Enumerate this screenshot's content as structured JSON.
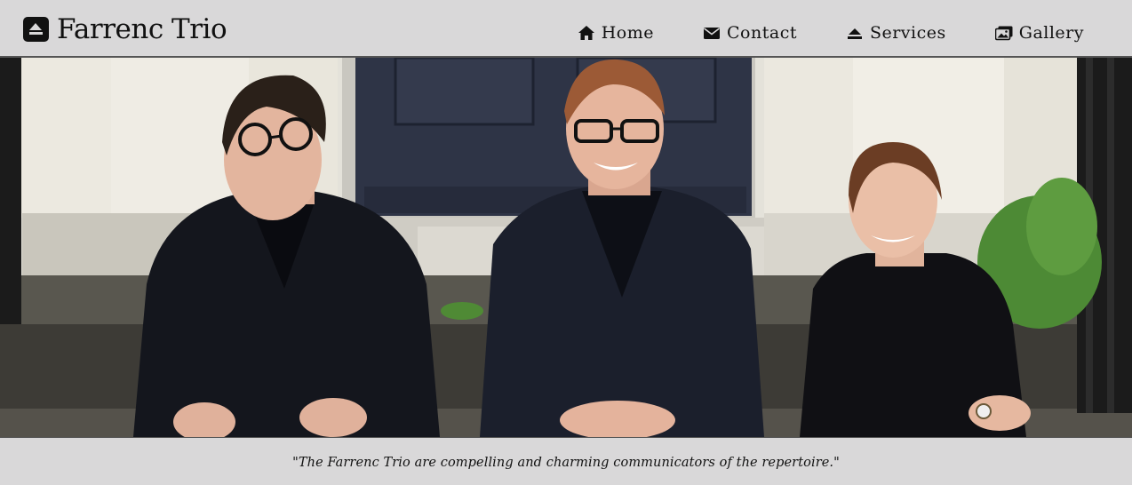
{
  "brand": {
    "name": "Farrenc Trio",
    "icon": "eject-square-icon"
  },
  "nav": {
    "items": [
      {
        "label": "Home",
        "icon": "home-icon"
      },
      {
        "label": "Contact",
        "icon": "envelope-icon"
      },
      {
        "label": "Services",
        "icon": "eject-icon"
      },
      {
        "label": "Gallery",
        "icon": "images-icon"
      }
    ]
  },
  "hero": {
    "image": "trio-photo"
  },
  "quote": {
    "text": "\"The Farrenc Trio are compelling and charming communicators of the repertoire.\""
  },
  "colors": {
    "header_bg": "#d9d8d9",
    "text": "#111111",
    "door": "#2e3446",
    "suit": "#14161d"
  }
}
